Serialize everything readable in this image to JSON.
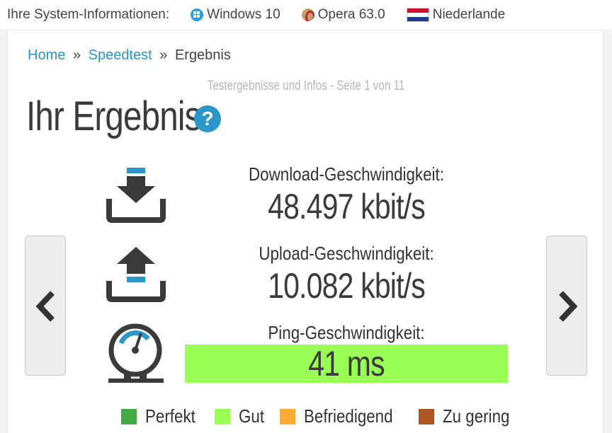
{
  "sysbar": {
    "label": "Ihre System-Informationen:",
    "os": "Windows 10",
    "browser": "Opera 63.0",
    "country": "Niederlande"
  },
  "breadcrumb": {
    "home": "Home",
    "sep1": "»",
    "speedtest": "Speedtest",
    "sep2": "»",
    "current": "Ergebnis"
  },
  "page": {
    "subtitle": "Testergebnisse und Infos - Seite 1 von 11",
    "title": "Ihr Ergebnis",
    "help": "?"
  },
  "download": {
    "label": "Download-Geschwindigkeit:",
    "value": "48.497 kbit/s"
  },
  "upload": {
    "label": "Upload-Geschwindigkeit:",
    "value": "10.082 kbit/s"
  },
  "ping": {
    "label": "Ping-Geschwindigkeit:",
    "value": "41 ms",
    "color": "#99ff55"
  },
  "legend": [
    {
      "label": "Perfekt",
      "color": "#44aa44"
    },
    {
      "label": "Gut",
      "color": "#99ff55"
    },
    {
      "label": "Befriedigend",
      "color": "#ffaa33"
    },
    {
      "label": "Zu gering",
      "color": "#aa5522"
    }
  ],
  "icons": {
    "download": "download-icon",
    "upload": "upload-icon",
    "ping": "gauge-icon",
    "prev": "chevron-left-icon",
    "next": "chevron-right-icon"
  },
  "colors": {
    "accent": "#2a97c8",
    "icon_dark": "#3a3a3a",
    "icon_blue": "#2a97c8"
  }
}
